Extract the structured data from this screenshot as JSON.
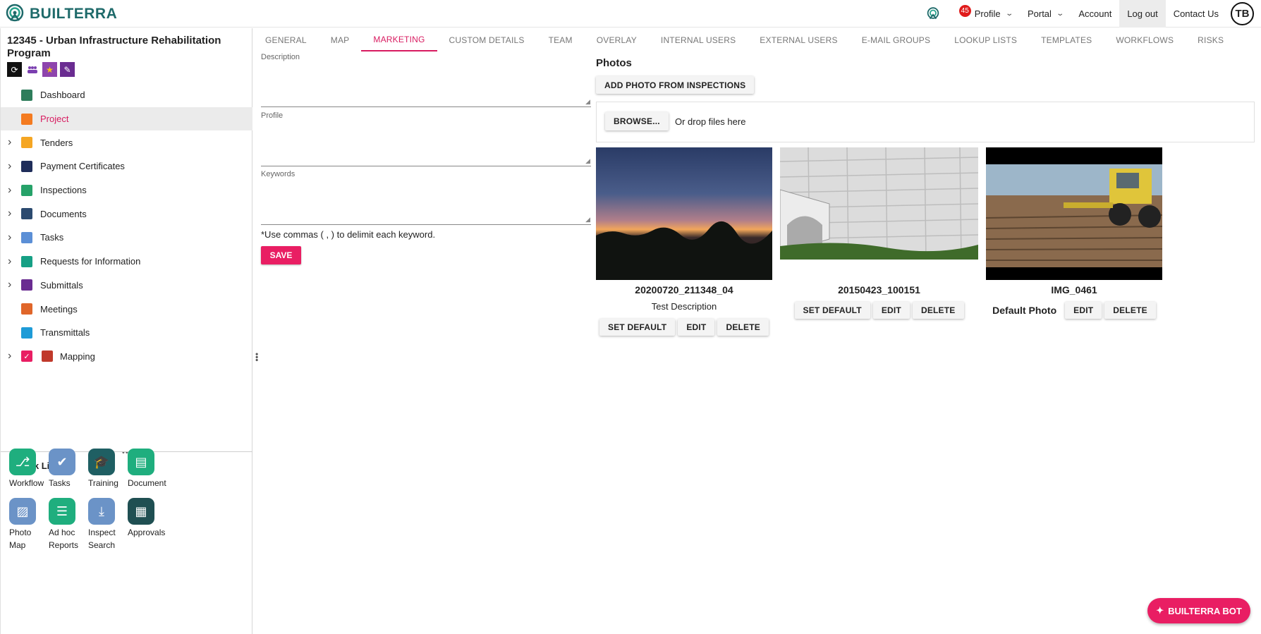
{
  "brand": {
    "name": "BUILTERRA"
  },
  "topnav": {
    "notification_count": "45",
    "profile": "Profile",
    "portal": "Portal",
    "account": "Account",
    "logout": "Log out",
    "contact": "Contact Us",
    "avatar_initials": "TB"
  },
  "project": {
    "title": "12345 - Urban Infrastructure Rehabilitation Program"
  },
  "sidebar": {
    "items": [
      {
        "label": "Dashboard",
        "expandable": false,
        "icon": "dashboard-icon",
        "color": "#2e7d5b"
      },
      {
        "label": "Project",
        "expandable": false,
        "icon": "project-icon",
        "color": "#f47b20",
        "active": true
      },
      {
        "label": "Tenders",
        "expandable": true,
        "icon": "tenders-icon",
        "color": "#f5a623"
      },
      {
        "label": "Payment Certificates",
        "expandable": true,
        "icon": "payment-certificates-icon",
        "color": "#1f2d5a"
      },
      {
        "label": "Inspections",
        "expandable": true,
        "icon": "inspections-icon",
        "color": "#26a269"
      },
      {
        "label": "Documents",
        "expandable": true,
        "icon": "documents-icon",
        "color": "#2b4a6f"
      },
      {
        "label": "Tasks",
        "expandable": true,
        "icon": "tasks-icon",
        "color": "#5b8fd6"
      },
      {
        "label": "Requests for Information",
        "expandable": true,
        "icon": "rfi-icon",
        "color": "#16a085"
      },
      {
        "label": "Submittals",
        "expandable": true,
        "icon": "submittals-icon",
        "color": "#6a2c91"
      },
      {
        "label": "Meetings",
        "expandable": false,
        "icon": "meetings-icon",
        "color": "#e0662a"
      },
      {
        "label": "Transmittals",
        "expandable": false,
        "icon": "transmittals-icon",
        "color": "#1e9bd7"
      },
      {
        "label": "Mapping",
        "expandable": true,
        "icon": "mapping-icon",
        "color": "#c0392b"
      }
    ]
  },
  "quick_links": {
    "title": "Quick Links",
    "items": [
      {
        "label": "Workflow",
        "icon": "workflow-icon",
        "color": "#1fae7e"
      },
      {
        "label": "Tasks",
        "icon": "tasks-check-icon",
        "color": "#6b93c7"
      },
      {
        "label": "Training",
        "icon": "training-cap-icon",
        "color": "#1f5f63"
      },
      {
        "label": "Document",
        "icon": "document-tray-icon",
        "color": "#1fae7e"
      },
      {
        "label": "Photo Map",
        "icon": "photo-map-icon",
        "color": "#6b93c7"
      },
      {
        "label": "Ad hoc Reports",
        "icon": "reports-icon",
        "color": "#1fae7e"
      },
      {
        "label": "Inspect Search",
        "icon": "download-icon",
        "color": "#6b93c7"
      },
      {
        "label": "Approvals",
        "icon": "approvals-icon",
        "color": "#1f4f52"
      }
    ]
  },
  "tabs": [
    "GENERAL",
    "MAP",
    "MARKETING",
    "CUSTOM DETAILS",
    "TEAM",
    "OVERLAY",
    "INTERNAL USERS",
    "EXTERNAL USERS",
    "E-MAIL GROUPS",
    "LOOKUP LISTS",
    "TEMPLATES",
    "WORKFLOWS",
    "RISKS"
  ],
  "active_tab": "MARKETING",
  "form": {
    "description_label": "Description",
    "description_value": "",
    "profile_label": "Profile",
    "profile_value": "",
    "keywords_label": "Keywords",
    "keywords_value": "",
    "hint": "*Use commas ( , ) to delimit each keyword.",
    "save": "SAVE"
  },
  "photos": {
    "title": "Photos",
    "add_from_inspections": "ADD PHOTO FROM INSPECTIONS",
    "browse": "BROWSE...",
    "drop_text": "Or drop files here",
    "items": [
      {
        "name": "20200720_211348_04",
        "description": "Test Description",
        "set_default": "SET DEFAULT",
        "edit": "EDIT",
        "delete": "DELETE"
      },
      {
        "name": "20150423_100151",
        "description": "",
        "set_default": "SET DEFAULT",
        "edit": "EDIT",
        "delete": "DELETE"
      },
      {
        "name": "IMG_0461",
        "description": "",
        "default_label": "Default Photo",
        "edit": "EDIT",
        "delete": "DELETE"
      }
    ]
  },
  "bot": {
    "label": "BUILTERRA BOT"
  },
  "colors": {
    "accent": "#e91e63",
    "brand": "#1e6a6a"
  }
}
